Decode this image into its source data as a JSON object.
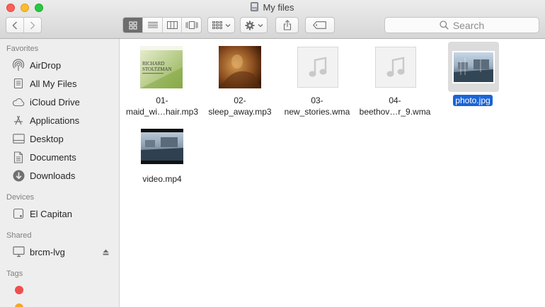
{
  "window": {
    "title": "My files"
  },
  "toolbar": {
    "search_placeholder": "Search",
    "view_modes": [
      "icon-view",
      "list-view",
      "column-view",
      "cover-flow-view"
    ],
    "active_view": "icon-view"
  },
  "sidebar": {
    "sections": [
      {
        "heading": "Favorites",
        "items": [
          {
            "label": "AirDrop",
            "icon": "airdrop-icon"
          },
          {
            "label": "All My Files",
            "icon": "all-files-icon"
          },
          {
            "label": "iCloud Drive",
            "icon": "cloud-icon"
          },
          {
            "label": "Applications",
            "icon": "applications-icon"
          },
          {
            "label": "Desktop",
            "icon": "desktop-icon"
          },
          {
            "label": "Documents",
            "icon": "document-icon"
          },
          {
            "label": "Downloads",
            "icon": "download-icon"
          }
        ]
      },
      {
        "heading": "Devices",
        "items": [
          {
            "label": "El Capitan",
            "icon": "hard-drive-icon"
          }
        ]
      },
      {
        "heading": "Shared",
        "items": [
          {
            "label": "brcm-lvg",
            "icon": "monitor-icon"
          }
        ]
      },
      {
        "heading": "Tags",
        "items": []
      }
    ],
    "tag_colors": [
      "#f14e4e",
      "#f5a623"
    ]
  },
  "files": [
    {
      "line1": "01-",
      "line2": "maid_wi…hair.mp3",
      "thumb": "album-art-richard-stoltzman"
    },
    {
      "line1": "02-",
      "line2": "sleep_away.mp3",
      "thumb": "album-art-brown"
    },
    {
      "line1": "03-",
      "line2": "new_stories.wma",
      "thumb": "music-note-icon"
    },
    {
      "line1": "04-",
      "line2": "beethov…r_9.wma",
      "thumb": "music-note-icon"
    },
    {
      "line1": "photo.jpg",
      "line2": "",
      "thumb": "photo-harbor",
      "selected": true
    },
    {
      "line1": "video.mp4",
      "line2": "",
      "thumb": "video-harbor"
    }
  ],
  "album_text": {
    "artist_line1": "RICHARD",
    "artist_line2": "STOLTZMAN"
  },
  "colors": {
    "selection": "#1a64d6",
    "selection_bg": "#dcdcdc",
    "sidebar_bg": "#eeeeef"
  }
}
